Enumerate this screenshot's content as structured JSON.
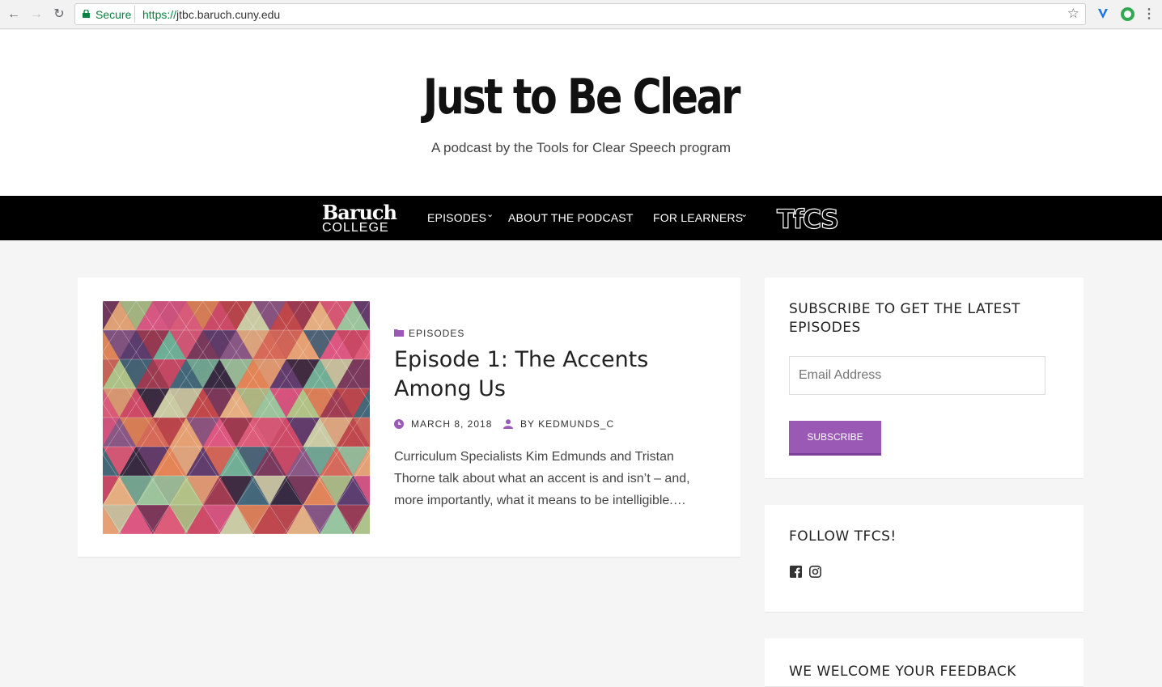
{
  "browser": {
    "secure_label": "Secure",
    "url_scheme": "https://",
    "url_host": "jtbc.baruch.cuny.edu"
  },
  "header": {
    "title": "Just to Be Clear",
    "tagline": "A podcast by the Tools for Clear Speech program"
  },
  "nav": {
    "logo_left_top": "Baruch",
    "logo_left_bottom": "COLLEGE",
    "items": [
      {
        "label": "EPISODES",
        "has_dropdown": true
      },
      {
        "label": "ABOUT THE PODCAST",
        "has_dropdown": false
      },
      {
        "label": "FOR LEARNERS",
        "has_dropdown": true
      }
    ],
    "logo_right": "TfCS"
  },
  "post": {
    "category": "EPISODES",
    "title": "Episode 1: The Accents Among Us",
    "date": "MARCH 8, 2018",
    "author": "BY KEDMUNDS_C",
    "excerpt": "Curriculum Specialists Kim Edmunds and Tristan Thorne talk about what an accent is and isn’t – and, more importantly, what it means to be intelligible.…"
  },
  "sidebar": {
    "subscribe_title": "SUBSCRIBE TO GET THE LATEST EPISODES",
    "email_placeholder": "Email Address",
    "subscribe_button": "SUBSCRIBE",
    "follow_title": "FOLLOW TFCS!",
    "social_icons": [
      "facebook-icon",
      "instagram-icon"
    ],
    "feedback_title": "WE WELCOME YOUR FEEDBACK"
  },
  "colors": {
    "accent": "#9b59b6",
    "nav_bg": "#000000",
    "page_bg": "#f5f5f5"
  }
}
